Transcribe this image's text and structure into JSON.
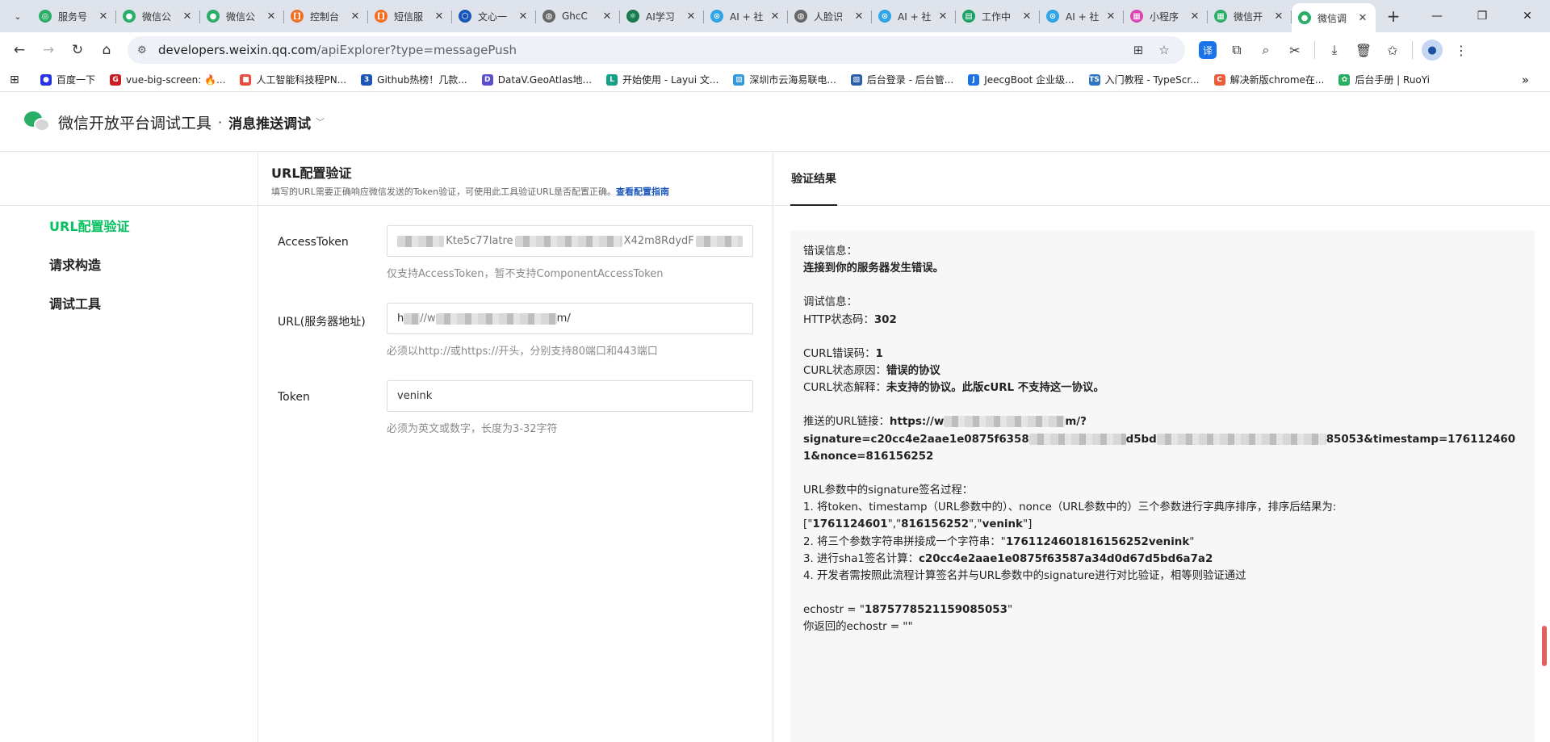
{
  "browser": {
    "tabs": [
      {
        "title": "服务号",
        "fav_color": "#2aae67",
        "glyph": "◎"
      },
      {
        "title": "微信公",
        "fav_color": "#2aae67",
        "glyph": "●"
      },
      {
        "title": "微信公",
        "fav_color": "#2aae67",
        "glyph": "●"
      },
      {
        "title": "控制台",
        "fav_color": "#f36e21",
        "glyph": "[]"
      },
      {
        "title": "短信服",
        "fav_color": "#f36e21",
        "glyph": "[]"
      },
      {
        "title": "文心一",
        "fav_color": "#1a56b8",
        "glyph": "⬡"
      },
      {
        "title": "GhcC",
        "fav_color": "#666666",
        "glyph": "◍"
      },
      {
        "title": "AI学习",
        "fav_color": "#16794f",
        "glyph": "⚛"
      },
      {
        "title": "AI + 社",
        "fav_color": "#2fa4e7",
        "glyph": "⊙"
      },
      {
        "title": "人脸识",
        "fav_color": "#666666",
        "glyph": "◍"
      },
      {
        "title": "AI + 社",
        "fav_color": "#2fa4e7",
        "glyph": "⊙"
      },
      {
        "title": "工作中",
        "fav_color": "#1aa260",
        "glyph": "▤"
      },
      {
        "title": "AI + 社",
        "fav_color": "#2fa4e7",
        "glyph": "⊙"
      },
      {
        "title": "小程序",
        "fav_color": "#d946b0",
        "glyph": "▦"
      },
      {
        "title": "微信开",
        "fav_color": "#2aae67",
        "glyph": "▦"
      },
      {
        "title": "微信调",
        "fav_color": "#2aae67",
        "glyph": "●"
      }
    ],
    "url_host": "developers.weixin.qq.com",
    "url_path": "/apiExplorer?type=messagePush",
    "bookmarks": [
      {
        "label": "百度一下",
        "color": "#2932e1",
        "glyph": "●"
      },
      {
        "label": "vue-big-screen: 🔥...",
        "color": "#c71d23",
        "glyph": "G"
      },
      {
        "label": "人工智能科技程PN...",
        "color": "#e74c3c",
        "glyph": "■"
      },
      {
        "label": "Github热榜！几款...",
        "color": "#1a56b8",
        "glyph": "3"
      },
      {
        "label": "DataV.GeoAtlas地...",
        "color": "#5a4fcf",
        "glyph": "D"
      },
      {
        "label": "开始使用 - Layui 文...",
        "color": "#16a085",
        "glyph": "L"
      },
      {
        "label": "深圳市云海易联电...",
        "color": "#3498db",
        "glyph": "▧"
      },
      {
        "label": "后台登录 - 后台管...",
        "color": "#2c5fa8",
        "glyph": "▧"
      },
      {
        "label": "JeecgBoot 企业级...",
        "color": "#1a73e8",
        "glyph": "J"
      },
      {
        "label": "入门教程 - TypeScr...",
        "color": "#2f74c0",
        "glyph": "TS"
      },
      {
        "label": "解决新版chrome在...",
        "color": "#e85d3c",
        "glyph": "C"
      },
      {
        "label": "后台手册 | RuoYi",
        "color": "#27ae60",
        "glyph": "✿"
      }
    ]
  },
  "app": {
    "title": "微信开放平台调试工具",
    "separator": "·",
    "section": "消息推送调试"
  },
  "sidebar": {
    "items": [
      {
        "label": "URL配置验证",
        "active": true
      },
      {
        "label": "请求构造",
        "active": false
      },
      {
        "label": "调试工具",
        "active": false
      }
    ]
  },
  "form": {
    "title": "URL配置验证",
    "desc": "填写的URL需要正确响应微信发送的Token验证，可使用此工具验证URL是否配置正确。",
    "guide_link": "查看配置指南",
    "fields": [
      {
        "label": "AccessToken",
        "visible_middle": "Kte5c77latre",
        "visible_tail": "X42m8RdydF",
        "hint": "仅支持AccessToken，暂不支持ComponentAccessToken"
      },
      {
        "label": "URL(服务器地址)",
        "visible_head": "h",
        "visible_mid": "//w",
        "visible_tail": "m/",
        "hint": "必须以http://或https://开头，分别支持80端口和443端口"
      },
      {
        "label": "Token",
        "value": "venink",
        "hint": "必须为英文或数字，长度为3-32字符"
      }
    ]
  },
  "result": {
    "tab": "验证结果",
    "error_label": "错误信息：",
    "error_msg": "连接到你的服务器发生错误。",
    "debug_label": "调试信息：",
    "http_label": "HTTP状态码：",
    "http_code": "302",
    "curl_err_label": "CURL错误码：",
    "curl_err": "1",
    "curl_reason_label": "CURL状态原因：",
    "curl_reason": "错误的协议",
    "curl_explain_label": "CURL状态解释：",
    "curl_explain": "未支持的协议。此版cURL 不支持这一协议。",
    "push_label": "推送的URL链接：",
    "push_head": "https://w",
    "push_mid": "m/?",
    "sig_head": "signature=c20cc4e2aae1e0875f6358",
    "sig_mid": "d5bd",
    "sig_tail": "85053&timestamp=1761124601&nonce=816156252",
    "sig_title": "URL参数中的signature签名过程：",
    "step1": "1. 将token、timestamp（URL参数中的）、nonce（URL参数中的）三个参数进行字典序排序，排序后结果为:",
    "step1_open": "[\"",
    "step1_a": "1761124601",
    "step1_sep1": "\",\"",
    "step1_b": "816156252",
    "step1_sep2": "\",\"",
    "step1_c": "venink",
    "step1_close": "\"]",
    "step2_label": "2. 将三个参数字符串拼接成一个字符串：\"",
    "step2_value": "1761124601816156252venink",
    "step2_close": "\"",
    "step3_label": "3. 进行sha1签名计算：",
    "step3_value": "c20cc4e2aae1e0875f63587a34d0d67d5bd6a7a2",
    "step4": "4. 开发者需按照此流程计算签名并与URL参数中的signature进行对比验证，相等则验证通过",
    "echostr_label": "echostr = \"",
    "echostr_value": "1875778521159085053",
    "echostr_close": "\"",
    "returned_label": "你返回的echostr = \"\""
  }
}
